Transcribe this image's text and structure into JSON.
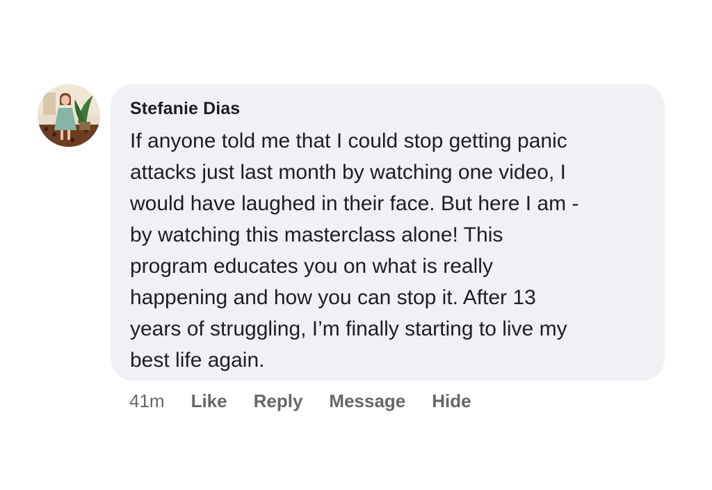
{
  "comment": {
    "author": "Stefanie Dias",
    "lines": [
      "If anyone told me that I could stop getting panic",
      "attacks just last month by watching one video, I",
      "would have laughed in their face. But here I am -",
      "by watching this masterclass alone! This",
      "program educates you on what is really",
      "happening and how you can stop it. After 13",
      "years of struggling, I’m finally starting to live my",
      "best life again."
    ],
    "timestamp": "41m",
    "actions": {
      "like": "Like",
      "reply": "Reply",
      "message": "Message",
      "hide": "Hide"
    }
  },
  "colors": {
    "bubble": "#f0f1f5",
    "text": "#1c1e21",
    "secondary_text": "#65676b"
  },
  "icons": {
    "avatar": "profile-photo"
  }
}
